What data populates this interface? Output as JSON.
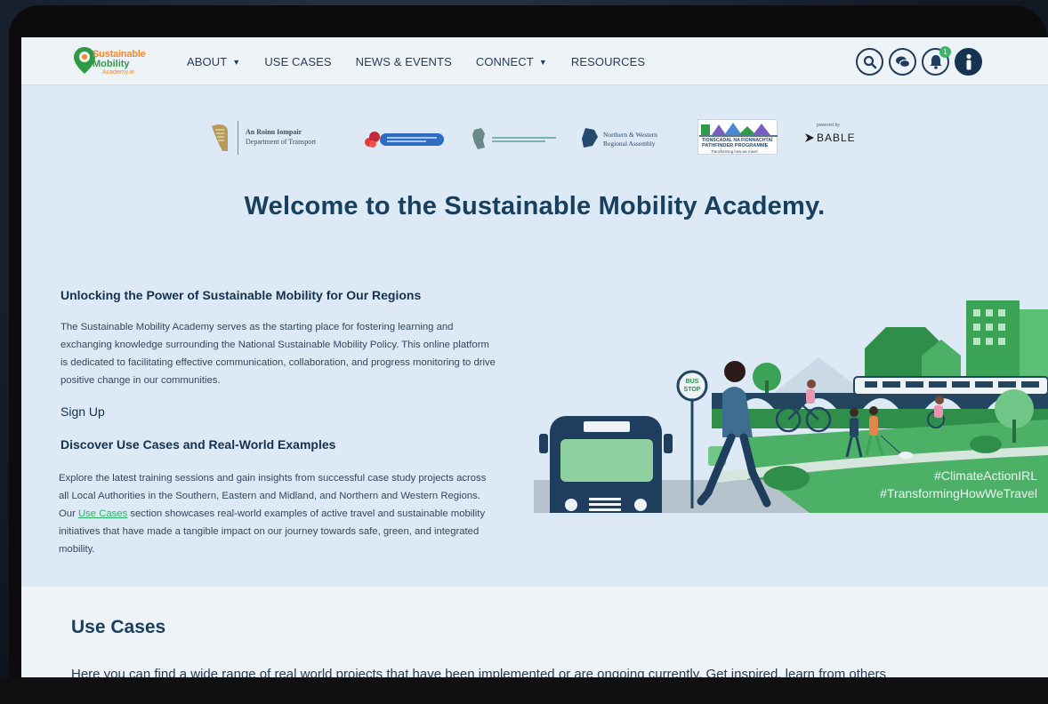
{
  "logo": {
    "line1": "Sustainable",
    "line2": "Mobility",
    "line3": "Academy.ie"
  },
  "nav": {
    "items": [
      {
        "label": "ABOUT",
        "dropdown": true
      },
      {
        "label": "USE CASES",
        "dropdown": false
      },
      {
        "label": "NEWS & EVENTS",
        "dropdown": false
      },
      {
        "label": "CONNECT",
        "dropdown": true
      },
      {
        "label": "RESOURCES",
        "dropdown": false
      }
    ],
    "notification_count": "1"
  },
  "partners": {
    "dot_line1": "An Roinn Iompair",
    "dot_line2": "Department of Transport",
    "nwra_line1": "Northern & Western",
    "nwra_line2": "Regional Assembly",
    "pathfinder_line1": "TIONSCADAL NA FIONNACHTAÍ",
    "pathfinder_line2": "PATHFINDER PROGRAMME",
    "pathfinder_line3": "Transforming how we travel",
    "bable_powered": "powered by",
    "bable_name": "BABLE"
  },
  "hero": {
    "title": "Welcome to the Sustainable Mobility Academy.",
    "heading1": "Unlocking the Power of Sustainable Mobility for Our Regions",
    "para1": "The Sustainable Mobility Academy serves as the starting place for fostering learning and exchanging knowledge surrounding the National Sustainable Mobility Policy. This online platform is dedicated to facilitating effective communication, collaboration, and progress monitoring to drive positive change in our communities.",
    "signup": "Sign Up",
    "heading2": "Discover Use Cases and Real-World Examples",
    "para2_before": "Explore the latest training sessions and gain insights from successful case study projects across all Local Authorities in the Southern, Eastern and Midland, and Northern and Western Regions. Our ",
    "para2_link": "Use Cases",
    "para2_after": " section showcases real-world examples of active travel and sustainable mobility initiatives that have made a tangible impact on our journey towards safe, green, and integrated mobility."
  },
  "illustration": {
    "bus_stop": [
      "BUS",
      "STOP"
    ],
    "hashtag1": "#ClimateActionIRL",
    "hashtag2": "#TransformingHowWeTravel"
  },
  "use_cases": {
    "title": "Use Cases",
    "intro": "Here you can find a wide range of real world projects that have been implemented or are ongoing currently. Get inspired, learn from others"
  },
  "colors": {
    "navy": "#17405f",
    "green": "#2fb36a",
    "orange": "#f08a2a",
    "background": "#dde9f4"
  }
}
